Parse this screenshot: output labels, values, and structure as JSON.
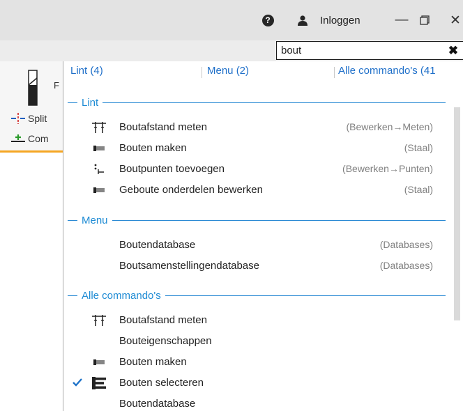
{
  "titlebar": {
    "help_icon": "question-circle-icon",
    "user_icon": "user-icon",
    "login_label": "Inloggen",
    "minimize_icon": "minimize-icon",
    "restore_icon": "restore-icon",
    "close_icon": "close-icon"
  },
  "search": {
    "value": "bout",
    "clear_icon": "close-x-icon"
  },
  "ribbon": {
    "split_label": "Split",
    "combine_label": "Com",
    "big_label": "F"
  },
  "tabs": {
    "lint": "Lint (4)",
    "menu": "Menu (2)",
    "all": "Alle commando's (41"
  },
  "sections": {
    "lint": {
      "title": "Lint",
      "items": [
        {
          "label": "Boutafstand meten",
          "path": "(Bewerken→Meten)",
          "icon": "bolt-distance-icon"
        },
        {
          "label": "Bouten maken",
          "path": "(Staal)",
          "icon": "bolt-icon"
        },
        {
          "label": "Boutpunten toevoegen",
          "path": "(Bewerken→Punten)",
          "icon": "bolt-points-icon"
        },
        {
          "label": "Geboute onderdelen bewerken",
          "path": "(Staal)",
          "icon": "bolt-icon"
        }
      ]
    },
    "menu": {
      "title": "Menu",
      "items": [
        {
          "label": "Boutendatabase",
          "path": "(Databases)"
        },
        {
          "label": "Boutsamenstellingendatabase",
          "path": "(Databases)"
        }
      ]
    },
    "all": {
      "title": "Alle commando's",
      "items": [
        {
          "label": "Boutafstand meten",
          "icon": "bolt-distance-icon"
        },
        {
          "label": "Bouteigenschappen"
        },
        {
          "label": "Bouten maken",
          "icon": "bolt-icon"
        },
        {
          "label": "Bouten selecteren",
          "icon": "select-bolts-icon",
          "checked": true
        },
        {
          "label": "Boutendatabase"
        }
      ]
    }
  },
  "colors": {
    "accent": "#1e8bd4",
    "tab_text": "#1e6fc9",
    "ribbon_highlight": "#f5a623"
  }
}
